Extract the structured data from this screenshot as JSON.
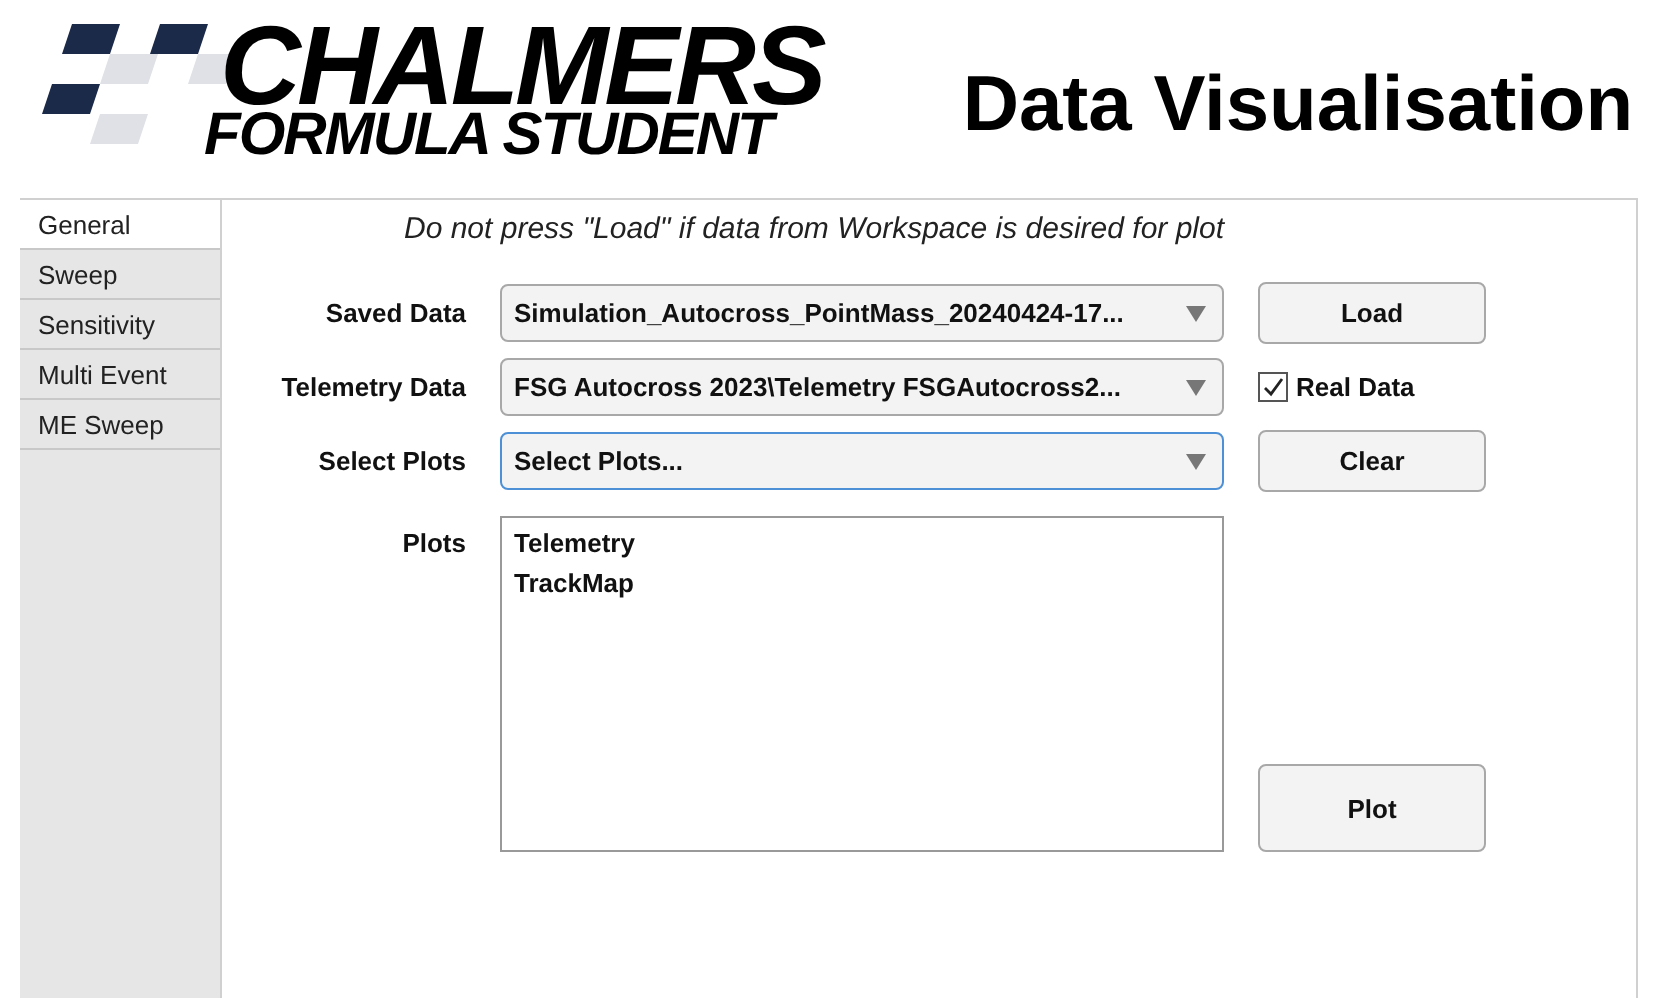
{
  "header": {
    "logo": {
      "title": "CHALMERS",
      "subtitle": "FORMULA STUDENT"
    },
    "title": "Data Visualisation"
  },
  "tabs": [
    {
      "label": "General",
      "selected": true
    },
    {
      "label": "Sweep",
      "selected": false
    },
    {
      "label": "Sensitivity",
      "selected": false
    },
    {
      "label": "Multi Event",
      "selected": false
    },
    {
      "label": "ME Sweep",
      "selected": false
    }
  ],
  "note": "Do not press \"Load\" if data from Workspace is desired for plot",
  "rows": [
    {
      "label": "Saved Data",
      "value": "Simulation_Autocross_PointMass_20240424-17...",
      "focused": false,
      "side": {
        "kind": "button",
        "label": "Load"
      }
    },
    {
      "label": "Telemetry Data",
      "value": "FSG Autocross 2023\\Telemetry FSGAutocross2...",
      "focused": false,
      "side": {
        "kind": "checkbox",
        "label": "Real Data",
        "checked": true
      }
    },
    {
      "label": "Select Plots",
      "value": "Select Plots...",
      "focused": true,
      "side": {
        "kind": "button",
        "label": "Clear"
      }
    }
  ],
  "plots": {
    "label": "Plots",
    "items": [
      "Telemetry",
      "TrackMap"
    ],
    "button": "Plot"
  }
}
